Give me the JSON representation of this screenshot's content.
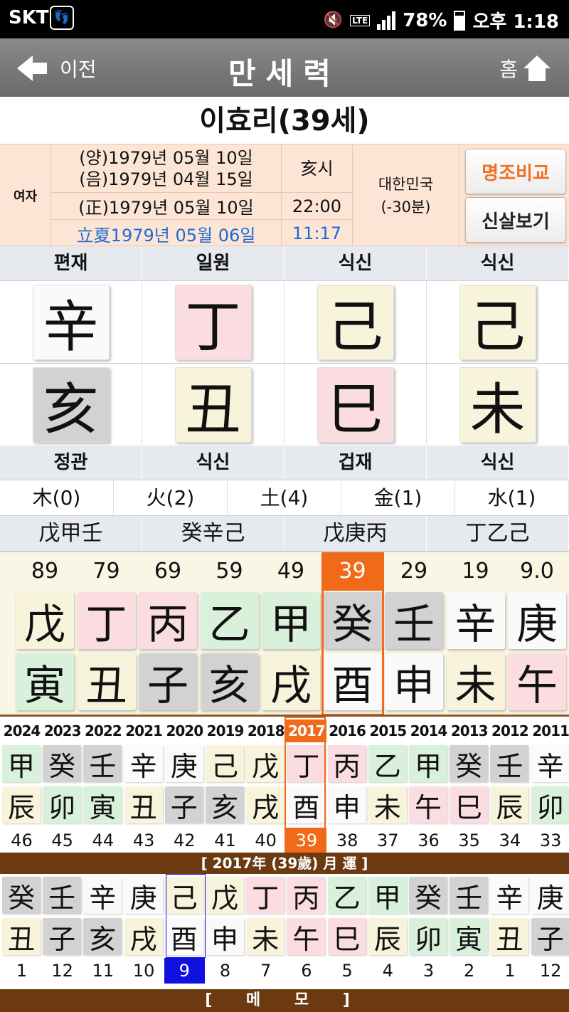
{
  "status_bar": {
    "carrier": "SKT",
    "lte": "LTE",
    "battery": "78%",
    "time": "오후 1:18"
  },
  "nav": {
    "back_label": "이전",
    "title": "만세력",
    "home_label": "홈"
  },
  "person": {
    "name": "이효리(39세)",
    "gender": "여자"
  },
  "dates": {
    "solar": "(양)1979년 05월 10일",
    "lunar": "(음)1979년 04월 15일",
    "corrected": "(正)1979년 05월 10일",
    "term": "立夏1979년 05월 06일",
    "hour_branch": "亥시",
    "time_corrected": "22:00",
    "term_time": "11:17",
    "country": "대한민국",
    "offset": "(-30분)"
  },
  "buttons": {
    "compare": "명조비교",
    "sinsal": "신살보기"
  },
  "pillars": {
    "top_labels": [
      "편재",
      "일원",
      "식신",
      "식신"
    ],
    "stems": [
      "辛",
      "丁",
      "己",
      "己"
    ],
    "branches": [
      "亥",
      "丑",
      "巳",
      "未"
    ],
    "bottom_labels": [
      "정관",
      "식신",
      "겁재",
      "식신"
    ]
  },
  "five_elements": [
    "木(0)",
    "火(2)",
    "土(4)",
    "金(1)",
    "水(1)"
  ],
  "hidden_stems": [
    "戊甲壬",
    "癸辛己",
    "戊庚丙",
    "丁乙己"
  ],
  "daeun": {
    "ages": [
      "89",
      "79",
      "69",
      "59",
      "49",
      "39",
      "29",
      "19",
      "9.0"
    ],
    "stems": [
      "戊",
      "丁",
      "丙",
      "乙",
      "甲",
      "癸",
      "壬",
      "辛",
      "庚"
    ],
    "branches": [
      "寅",
      "丑",
      "子",
      "亥",
      "戌",
      "酉",
      "申",
      "未",
      "午"
    ],
    "selected_age": "39"
  },
  "seun": {
    "years": [
      "2024",
      "2023",
      "2022",
      "2021",
      "2020",
      "2019",
      "2018",
      "2017",
      "2016",
      "2015",
      "2014",
      "2013",
      "2012",
      "2011"
    ],
    "stems": [
      "甲",
      "癸",
      "壬",
      "辛",
      "庚",
      "己",
      "戊",
      "丁",
      "丙",
      "乙",
      "甲",
      "癸",
      "壬",
      "辛"
    ],
    "branches": [
      "辰",
      "卯",
      "寅",
      "丑",
      "子",
      "亥",
      "戌",
      "酉",
      "申",
      "未",
      "午",
      "巳",
      "辰",
      "卯"
    ],
    "ages": [
      "46",
      "45",
      "44",
      "43",
      "42",
      "41",
      "40",
      "39",
      "38",
      "37",
      "36",
      "35",
      "34",
      "33"
    ],
    "selected_year": "2017"
  },
  "wolun": {
    "header": "[ 2017年 (39歲) 月 運 ]",
    "stems": [
      "癸",
      "壬",
      "辛",
      "庚",
      "己",
      "戊",
      "丁",
      "丙",
      "乙",
      "甲",
      "癸",
      "壬",
      "辛",
      "庚"
    ],
    "branches": [
      "丑",
      "子",
      "亥",
      "戌",
      "酉",
      "申",
      "未",
      "午",
      "巳",
      "辰",
      "卯",
      "寅",
      "丑",
      "子"
    ],
    "months": [
      "1",
      "12",
      "11",
      "10",
      "9",
      "8",
      "7",
      "6",
      "5",
      "4",
      "3",
      "2",
      "1",
      "12"
    ],
    "selected_month": "9"
  },
  "memo_label": "[ 메 모 ]",
  "colors": {
    "accent": "#f06a1a",
    "nav_bg": "#7a7a7a",
    "info_bg": "#fde5d5",
    "brown": "#6b3a10",
    "month_select": "#1010e0"
  }
}
